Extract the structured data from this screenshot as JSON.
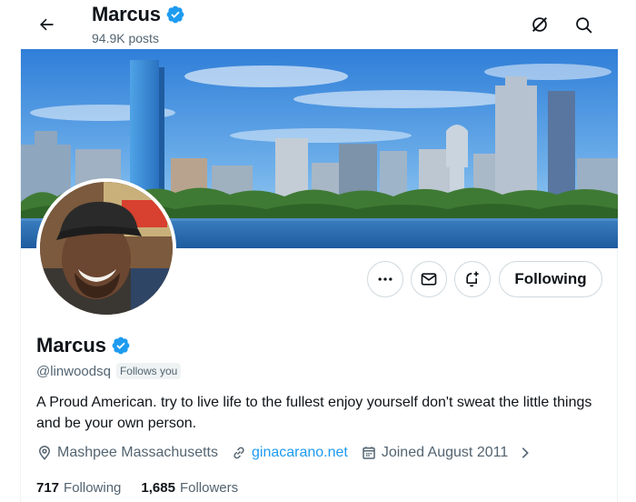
{
  "header": {
    "name": "Marcus",
    "posts": "94.9K posts",
    "back_icon": "arrow-left-icon",
    "grok_icon": "grok-icon",
    "search_icon": "search-icon"
  },
  "profile": {
    "name": "Marcus",
    "verified": true,
    "handle": "@linwoodsq",
    "follows_you": "Follows you",
    "bio": "A Proud American. try to live life to the fullest enjoy yourself don't sweat the little things and be your own person.",
    "location": "Mashpee Massachusetts",
    "website": "ginacarano.net",
    "joined": "Joined August 2011"
  },
  "actions": {
    "more_icon": "more-icon",
    "message_icon": "envelope-icon",
    "notify_icon": "bell-plus-icon",
    "following_label": "Following"
  },
  "stats": {
    "following_count": "717",
    "following_label": "Following",
    "followers_count": "1,685",
    "followers_label": "Followers"
  },
  "colors": {
    "accent": "#1d9bf0",
    "text": "#0f1419",
    "muted": "#536471",
    "border": "#cfd9de"
  }
}
